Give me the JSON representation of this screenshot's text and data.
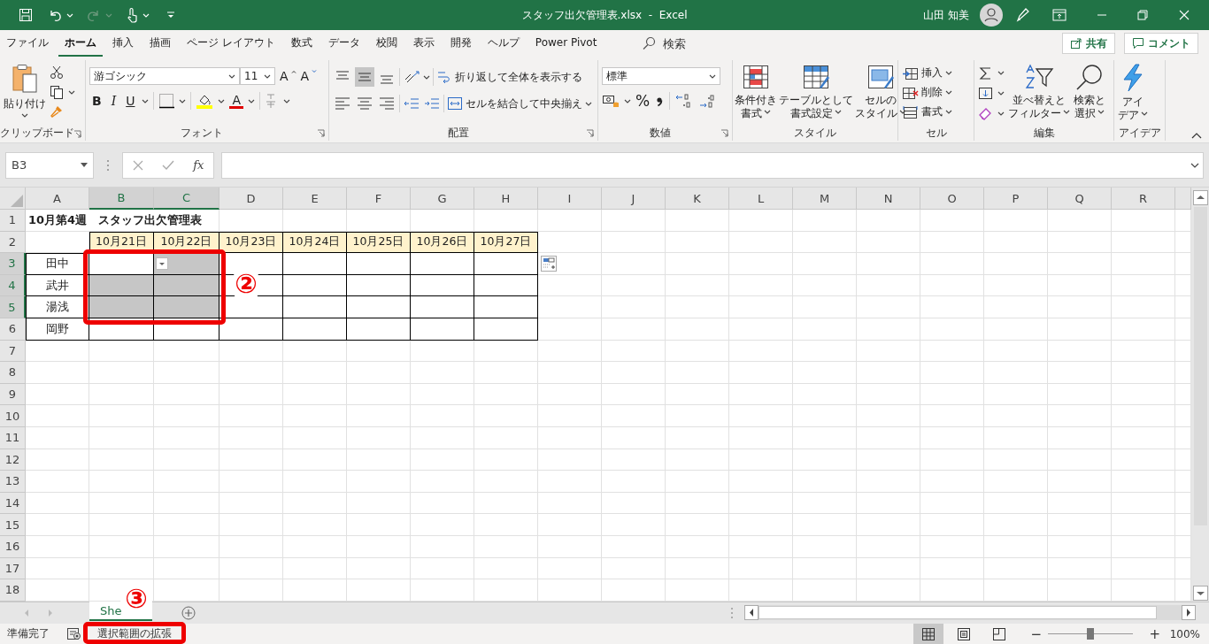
{
  "title_bar": {
    "title": "スタッフ出欠管理表.xlsx  -  Excel",
    "user": "山田 知美"
  },
  "menu_tabs": [
    {
      "label": "ファイル",
      "selected": false
    },
    {
      "label": "ホーム",
      "selected": true
    },
    {
      "label": "挿入",
      "selected": false
    },
    {
      "label": "描画",
      "selected": false
    },
    {
      "label": "ページ レイアウト",
      "selected": false
    },
    {
      "label": "数式",
      "selected": false
    },
    {
      "label": "データ",
      "selected": false
    },
    {
      "label": "校閲",
      "selected": false
    },
    {
      "label": "表示",
      "selected": false
    },
    {
      "label": "開発",
      "selected": false
    },
    {
      "label": "ヘルプ",
      "selected": false
    },
    {
      "label": "Power Pivot",
      "selected": false
    }
  ],
  "search": {
    "placeholder": "検索"
  },
  "share_button": "共有",
  "comment_button": "コメント",
  "ribbon_groups": [
    {
      "kind": "clipboard",
      "label": "クリップボード",
      "paste": "貼り付け"
    },
    {
      "kind": "font",
      "label": "フォント",
      "font_name": "游ゴシック",
      "font_size": "11",
      "grow": "A",
      "shrink": "A",
      "bold": "B",
      "italic": "I",
      "underline": "U",
      "font_color": "A"
    },
    {
      "kind": "alignment",
      "label": "配置",
      "wrap_text": "折り返して全体を表示する",
      "merge": "セルを結合して中央揃え",
      "vertical_align": [
        {
          "selected": false
        },
        {
          "selected": true
        },
        {
          "selected": false
        }
      ],
      "horizontal_align": [
        {
          "selected": false
        },
        {
          "selected": false
        },
        {
          "selected": false
        }
      ]
    },
    {
      "kind": "number",
      "label": "数値",
      "format": "標準",
      "percent": "%"
    },
    {
      "kind": "styles",
      "label": "スタイル",
      "buttons": [
        {
          "lines": [
            "条件付き",
            "書式"
          ]
        },
        {
          "lines": [
            "テーブルとして",
            "書式設定"
          ]
        },
        {
          "lines": [
            "セルの",
            "スタイル"
          ]
        }
      ]
    },
    {
      "kind": "cells",
      "label": "セル",
      "buttons": [
        "挿入",
        "削除",
        "書式"
      ]
    },
    {
      "kind": "editing",
      "label": "編集",
      "buttons": [
        {
          "lines": [
            "並べ替えと",
            "フィルター"
          ]
        },
        {
          "lines": [
            "検索と",
            "選択"
          ]
        }
      ]
    },
    {
      "kind": "ideas",
      "label": "アイデア",
      "button": {
        "lines": [
          "アイ",
          "デア"
        ]
      }
    }
  ],
  "formula_bar": {
    "name_box": "B3",
    "function_label": "fx"
  },
  "sheet": {
    "columns": [
      {
        "label": "A",
        "selected": false
      },
      {
        "label": "B",
        "selected": true
      },
      {
        "label": "C",
        "selected": true
      },
      {
        "label": "D",
        "selected": false
      },
      {
        "label": "E",
        "selected": false
      },
      {
        "label": "F",
        "selected": false
      },
      {
        "label": "G",
        "selected": false
      },
      {
        "label": "H",
        "selected": false
      },
      {
        "label": "I",
        "selected": false
      },
      {
        "label": "J",
        "selected": false
      },
      {
        "label": "K",
        "selected": false
      },
      {
        "label": "L",
        "selected": false
      },
      {
        "label": "M",
        "selected": false
      },
      {
        "label": "N",
        "selected": false
      },
      {
        "label": "O",
        "selected": false
      },
      {
        "label": "P",
        "selected": false
      },
      {
        "label": "Q",
        "selected": false
      },
      {
        "label": "R",
        "selected": false
      }
    ],
    "rows": [
      {
        "label": "1",
        "selected": false
      },
      {
        "label": "2",
        "selected": false
      },
      {
        "label": "3",
        "selected": true
      },
      {
        "label": "4",
        "selected": true
      },
      {
        "label": "5",
        "selected": true
      },
      {
        "label": "6",
        "selected": false
      },
      {
        "label": "7",
        "selected": false
      },
      {
        "label": "8",
        "selected": false
      },
      {
        "label": "9",
        "selected": false
      },
      {
        "label": "10",
        "selected": false
      },
      {
        "label": "11",
        "selected": false
      },
      {
        "label": "12",
        "selected": false
      },
      {
        "label": "13",
        "selected": false
      },
      {
        "label": "14",
        "selected": false
      },
      {
        "label": "15",
        "selected": false
      },
      {
        "label": "16",
        "selected": false
      },
      {
        "label": "17",
        "selected": false
      },
      {
        "label": "18",
        "selected": false
      }
    ],
    "title": "10月第4週　スタッフ出欠管理表",
    "dates": [
      "10月21日",
      "10月22日",
      "10月23日",
      "10月24日",
      "10月25日",
      "10月26日",
      "10月27日"
    ],
    "staff": [
      {
        "name": "田中"
      },
      {
        "name": "武井"
      },
      {
        "name": "湯浅"
      },
      {
        "name": "岡野"
      }
    ]
  },
  "sheet_tabs": [
    {
      "label": "She",
      "selected": true
    }
  ],
  "status_bar": {
    "ready": "準備完了",
    "mode": "選択範囲の拡張",
    "views": [
      {
        "selected": true
      },
      {
        "selected": false
      },
      {
        "selected": false
      }
    ],
    "zoom_minus": "−",
    "zoom_plus": "+",
    "zoom": {
      "level": 0.5
    },
    "zoom_text": "100%"
  },
  "annotations": [
    {
      "label": "②"
    },
    {
      "label": "③"
    }
  ]
}
